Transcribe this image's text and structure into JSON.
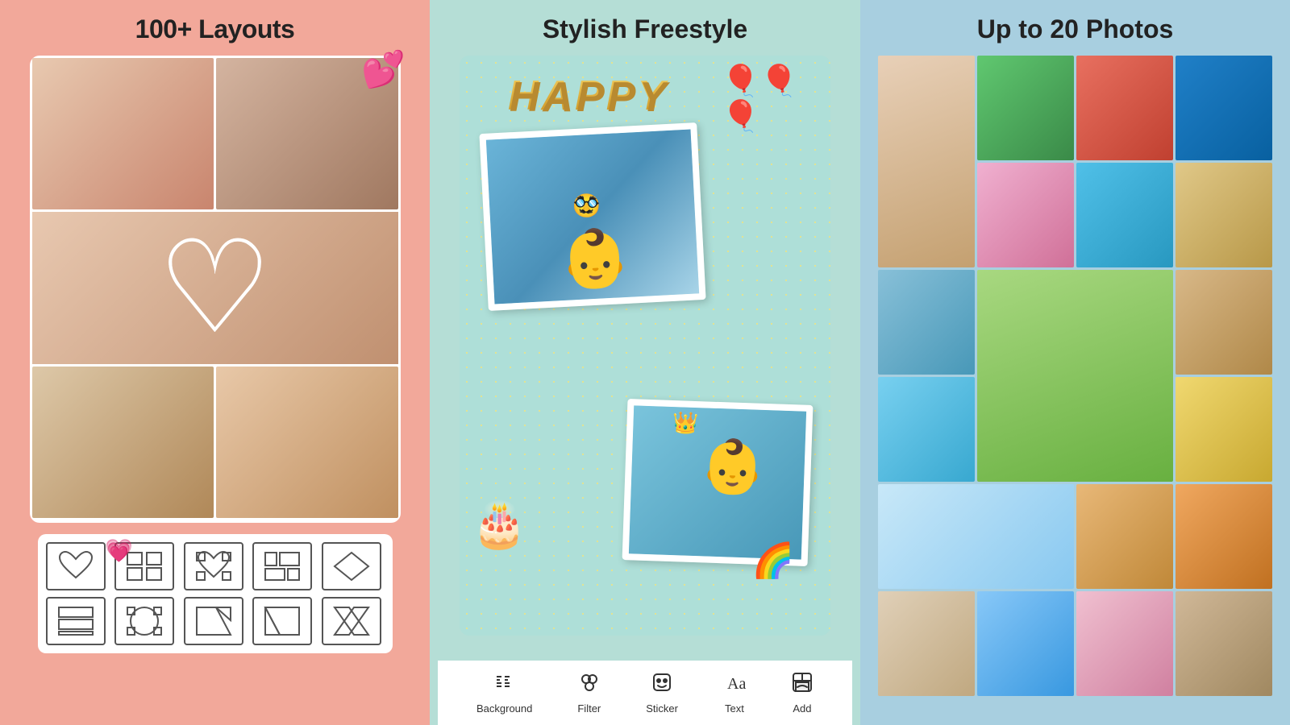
{
  "panel1": {
    "title": "100+ Layouts",
    "emoji_hearts": "💕",
    "emoji_heart_small": "💗",
    "layouts": [
      {
        "id": "heart",
        "label": "heart layout"
      },
      {
        "id": "grid4",
        "label": "4-grid layout"
      },
      {
        "id": "heart2",
        "label": "heart layout 2"
      },
      {
        "id": "grid5",
        "label": "5-grid layout"
      },
      {
        "id": "diamond",
        "label": "diamond layout"
      },
      {
        "id": "rect3",
        "label": "3-rect layout"
      },
      {
        "id": "circle",
        "label": "circle layout"
      },
      {
        "id": "diag1",
        "label": "diagonal layout 1"
      },
      {
        "id": "diag2",
        "label": "diagonal layout 2"
      },
      {
        "id": "cross",
        "label": "cross layout"
      }
    ]
  },
  "panel2": {
    "title": "Stylish Freestyle",
    "happy_text": "HAPPY",
    "balloons": "🎈",
    "cake": "🎂",
    "crown": "👑",
    "rainbow": "🌈",
    "toolbar": {
      "items": [
        {
          "id": "background",
          "icon": "background",
          "label": "Background"
        },
        {
          "id": "filter",
          "icon": "filter",
          "label": "Filter"
        },
        {
          "id": "sticker",
          "icon": "sticker",
          "label": "Sticker"
        },
        {
          "id": "text",
          "icon": "text",
          "label": "Text"
        },
        {
          "id": "add",
          "icon": "add",
          "label": "Add"
        }
      ]
    }
  },
  "panel3": {
    "title": "Up to 20 Photos"
  }
}
